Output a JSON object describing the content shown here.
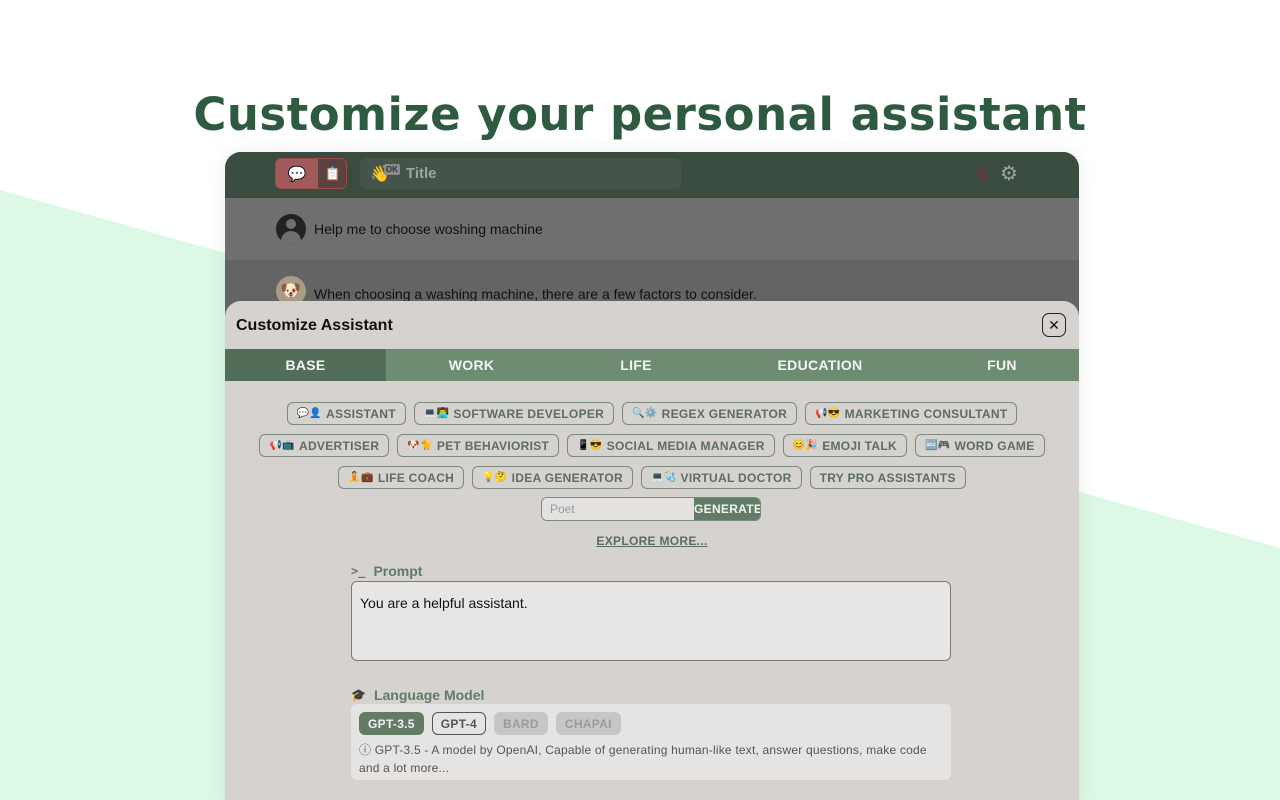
{
  "headline": "Customize your personal assistant",
  "colors": {
    "accent_green": "#617d66",
    "headline_green": "#2e5a3f",
    "mint_background": "#dcf9e6",
    "topbar": "#3a4b3f"
  },
  "app": {
    "topbar": {
      "chat_icon": "speech-bubble-icon",
      "doc_icon": "document-icon",
      "title_emoji": "👋",
      "title_badge": "OK",
      "title": "Title",
      "mic_icon": "microphone-icon",
      "settings_icon": "gear-icon"
    },
    "messages": [
      {
        "role": "user",
        "text": "Help me to choose woshing machine"
      },
      {
        "role": "assistant",
        "avatar": "🐶",
        "text": "When choosing a washing machine, there are a few factors to consider."
      }
    ]
  },
  "panel": {
    "title": "Customize Assistant",
    "close_icon": "close-icon",
    "tabs": [
      "BASE",
      "WORK",
      "LIFE",
      "EDUCATION",
      "FUN"
    ],
    "active_tab": "BASE",
    "assistant_rows": [
      [
        {
          "emoji": "💬👤",
          "label": "ASSISTANT"
        },
        {
          "emoji": "💻👨‍💻",
          "label": "SOFTWARE DEVELOPER"
        },
        {
          "emoji": "🔍⚙️",
          "label": "REGEX GENERATOR"
        },
        {
          "emoji": "📢😎",
          "label": "MARKETING CONSULTANT"
        }
      ],
      [
        {
          "emoji": "📢📺",
          "label": "ADVERTISER"
        },
        {
          "emoji": "🐶🐈",
          "label": "PET BEHAVIORIST"
        },
        {
          "emoji": "📱😎",
          "label": "SOCIAL MEDIA MANAGER"
        },
        {
          "emoji": "😊🎉",
          "label": "EMOJI TALK"
        },
        {
          "emoji": "🔤🎮",
          "label": "WORD GAME"
        }
      ],
      [
        {
          "emoji": "🧘💼",
          "label": "LIFE COACH"
        },
        {
          "emoji": "💡🤔",
          "label": "IDEA GENERATOR"
        },
        {
          "emoji": "💻🩺",
          "label": "VIRTUAL DOCTOR"
        },
        {
          "emoji": "",
          "label": "TRY PRO ASSISTANTS"
        }
      ]
    ],
    "generator": {
      "placeholder": "Poet",
      "button": "GENERATE"
    },
    "explore_link": "EXPLORE MORE...",
    "prompt": {
      "icon": "terminal-icon",
      "label": "Prompt",
      "value": "You are a helpful assistant."
    },
    "language_model": {
      "icon": "graduation-cap-icon",
      "label": "Language Model",
      "options": [
        {
          "label": "GPT-3.5",
          "state": "selected"
        },
        {
          "label": "GPT-4",
          "state": "normal"
        },
        {
          "label": "BARD",
          "state": "disabled"
        },
        {
          "label": "CHAPAI",
          "state": "disabled"
        }
      ],
      "description": "ⓘ GPT-3.5 - A model by OpenAI, Capable of generating human-like text, answer questions, make code and a lot more..."
    }
  }
}
